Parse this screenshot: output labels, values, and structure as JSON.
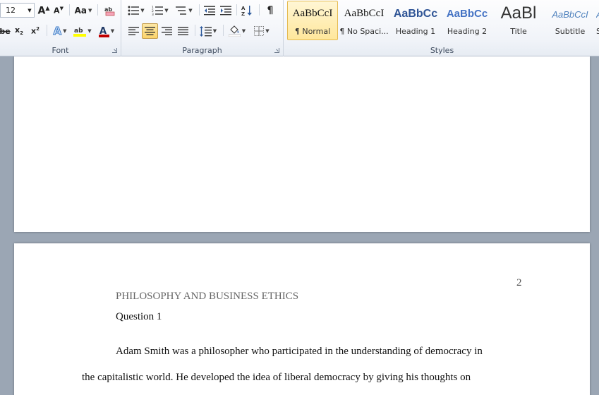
{
  "toolbar": {
    "font_size": "12",
    "font_group_label": "Font",
    "paragraph_group_label": "Paragraph",
    "styles_group_label": "Styles"
  },
  "styles": [
    {
      "sample": "AaBbCcI",
      "name": "¶ Normal"
    },
    {
      "sample": "AaBbCcI",
      "name": "¶ No Spaci..."
    },
    {
      "sample": "AaBbCc",
      "name": "Heading 1"
    },
    {
      "sample": "AaBbCc",
      "name": "Heading 2"
    },
    {
      "sample": "AaBl",
      "name": "Title"
    },
    {
      "sample": "AaBbCcI",
      "name": "Subtitle"
    },
    {
      "sample": "A",
      "name": "S"
    }
  ],
  "document": {
    "page_number": "2",
    "header_text": "PHILOSOPHY AND BUSINESS ETHICS",
    "heading": "Question 1",
    "body_line_1": "Adam Smith was a philosopher who participated in the understanding of democracy in",
    "body_line_2": "the capitalistic world. He developed the idea of liberal democracy by giving his thoughts on"
  },
  "colors": {
    "highlight": "#ffff00",
    "font_color": "#c00000",
    "accent": "#2b579a",
    "canvas_background": "#9ba6b4"
  }
}
